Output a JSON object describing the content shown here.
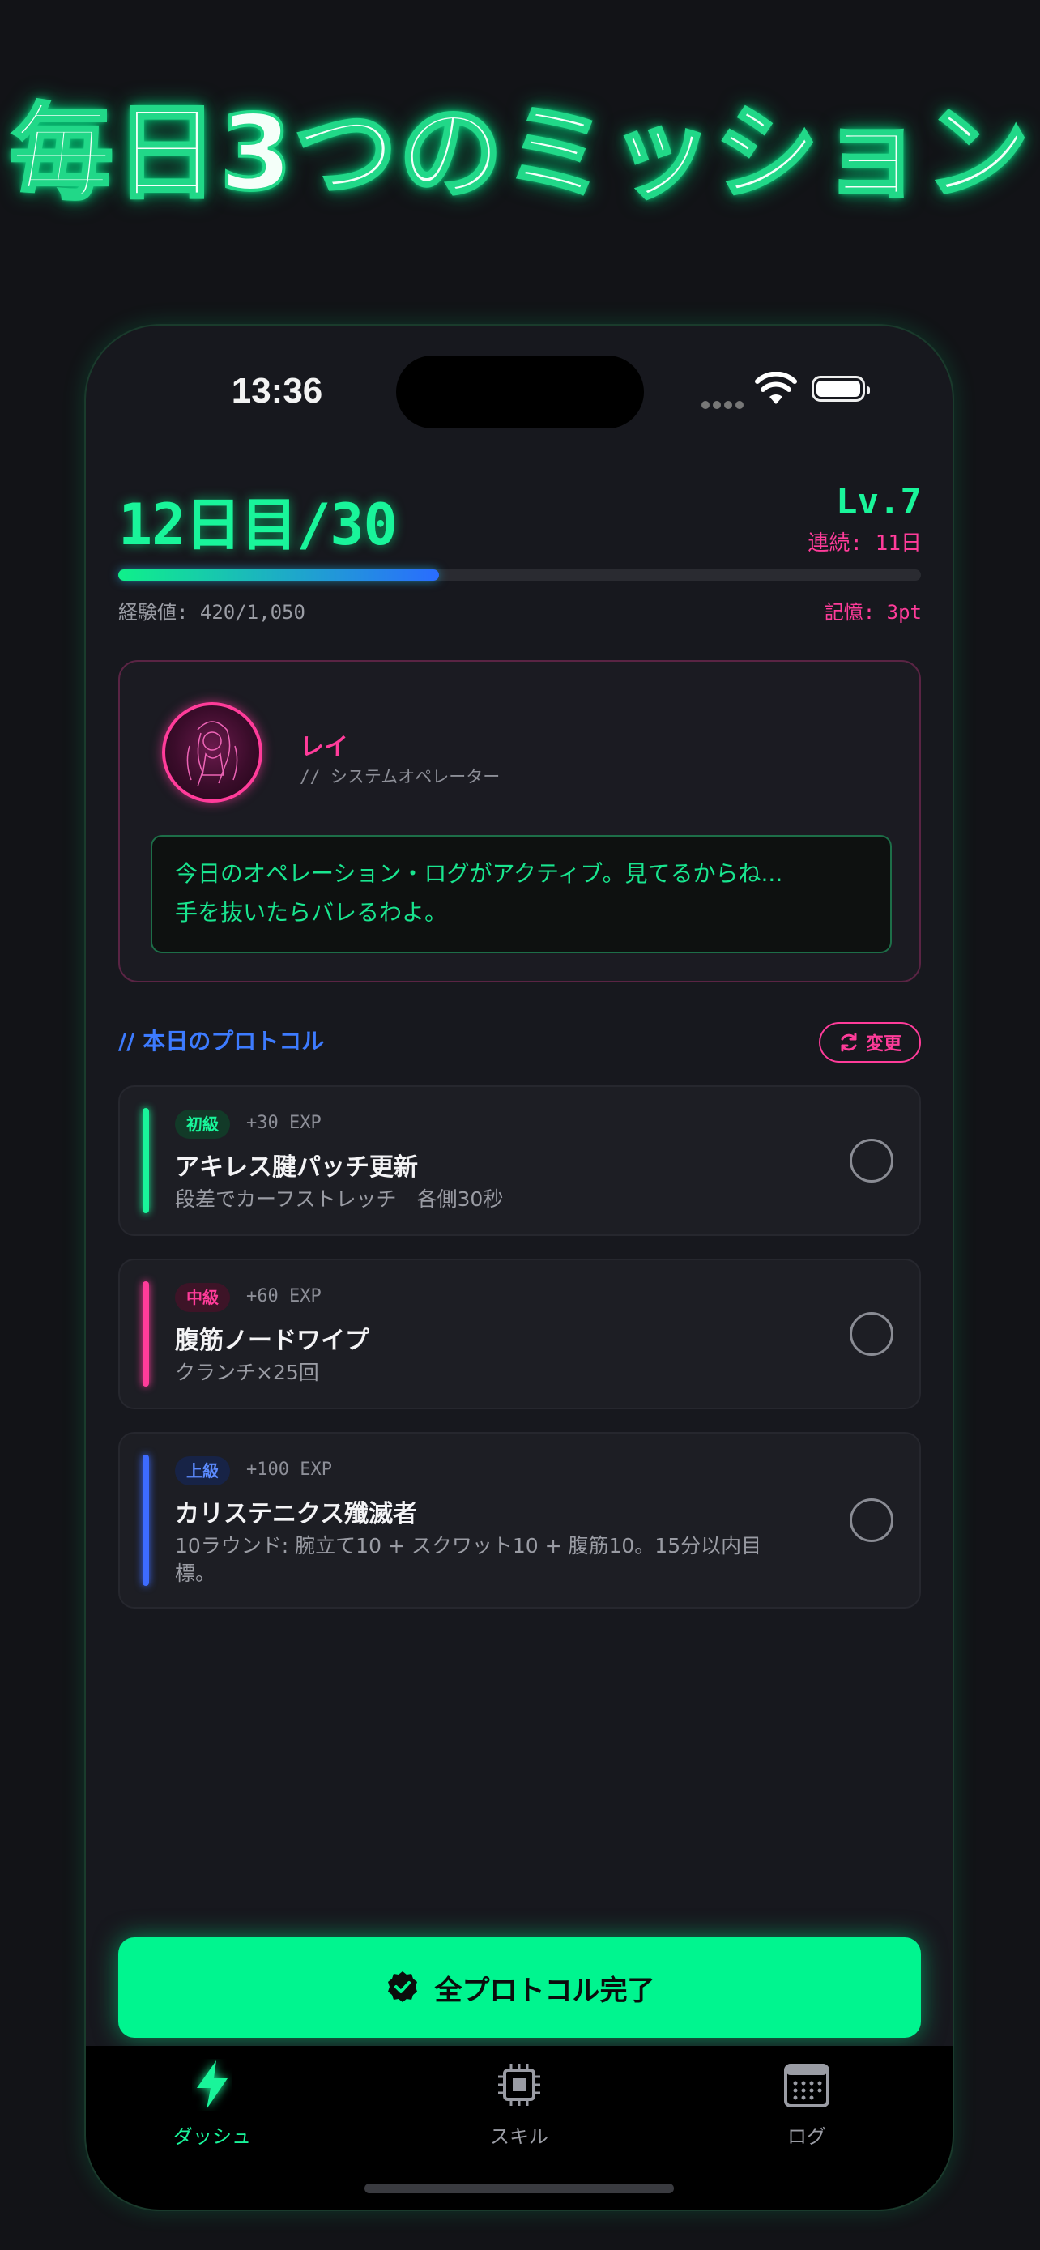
{
  "headline": "毎日3つのミッション",
  "status_bar": {
    "time": "13:36"
  },
  "header": {
    "day_title": "12日目/30",
    "level": "Lv.7",
    "streak": "連続: 11日",
    "exp_label": "経験値: 420/1,050",
    "memory_label": "記憶: 3pt",
    "progress": 0.4
  },
  "character": {
    "name": "レイ",
    "role": "// システムオペレーター",
    "message_line1": "今日のオペレーション・ログがアクティブ。見てるからね...",
    "message_line2": "手を抜いたらバレるわよ。"
  },
  "protocols": {
    "section_title": "// 本日のプロトコル",
    "change_label": "変更",
    "items": [
      {
        "level": "初級",
        "exp": "+30 EXP",
        "title": "アキレス腱パッチ更新",
        "desc": "段差でカーフストレッチ　各側30秒",
        "color": "#19f59a",
        "badge_bg": "#123a28"
      },
      {
        "level": "中級",
        "exp": "+60 EXP",
        "title": "腹筋ノードワイプ",
        "desc": "クランチ×25回",
        "color": "#ff3c9a",
        "badge_bg": "#3d1427"
      },
      {
        "level": "上級",
        "exp": "+100 EXP",
        "title": "カリステニクス殲滅者",
        "desc": "10ラウンド: 腕立て10 + スクワット10 + 腹筋10。15分以内目標。",
        "color": "#3d6bff",
        "badge_bg": "#172346"
      }
    ]
  },
  "cta": {
    "label": "全プロトコル完了"
  },
  "tabs": [
    {
      "label": "ダッシュ",
      "icon": "bolt-icon",
      "active": true
    },
    {
      "label": "スキル",
      "icon": "chip-icon",
      "active": false
    },
    {
      "label": "ログ",
      "icon": "calendar-icon",
      "active": false
    }
  ],
  "colors": {
    "accent_green": "#00f58f",
    "accent_pink": "#ff3c9a",
    "accent_blue": "#3d7bff"
  }
}
